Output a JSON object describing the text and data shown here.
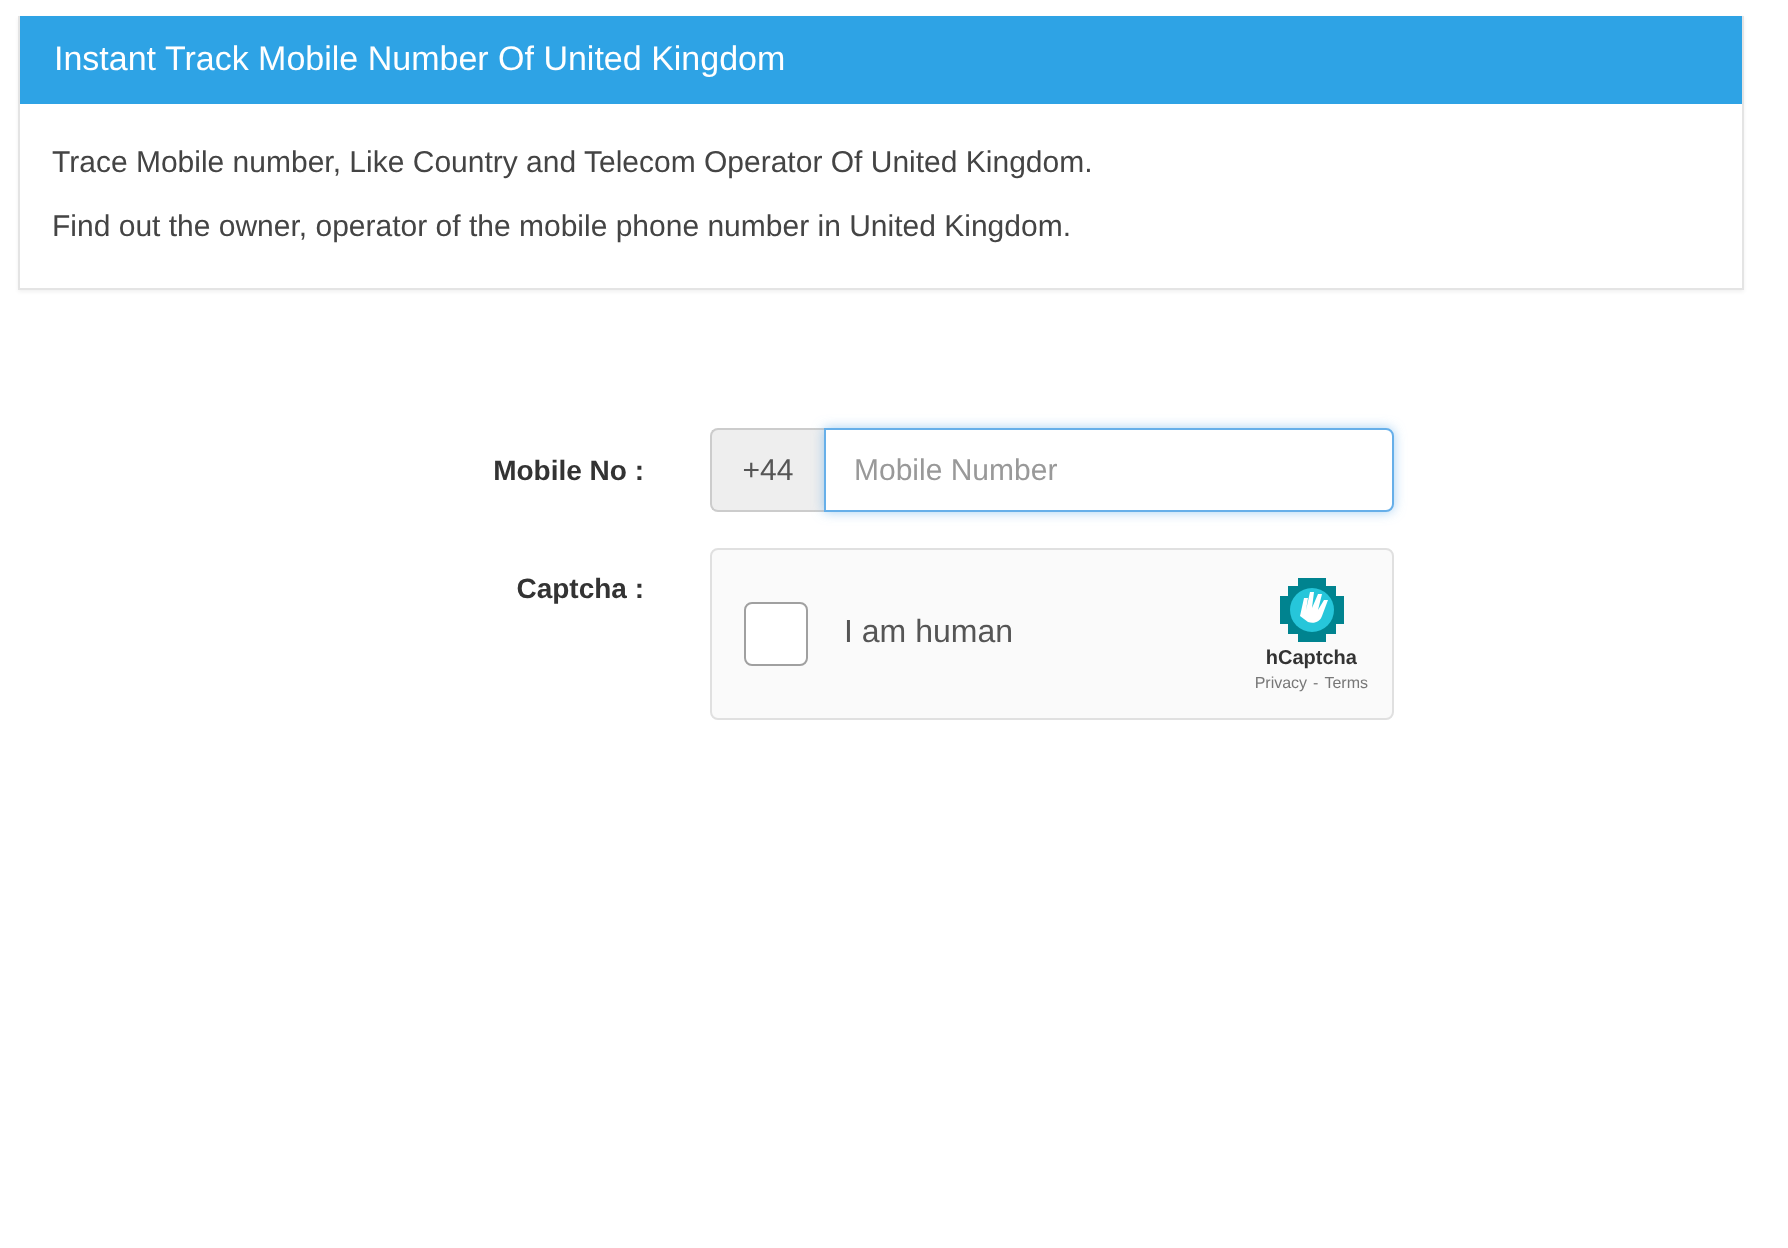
{
  "panel": {
    "title": "Instant Track Mobile Number Of United Kingdom",
    "lines": [
      "Trace Mobile number, Like Country and Telecom Operator Of United Kingdom.",
      "Find out the owner, operator of the mobile phone number in United Kingdom."
    ]
  },
  "form": {
    "mobile_label": "Mobile No :",
    "prefix": "+44",
    "mobile_placeholder": "Mobile Number",
    "captcha_label": "Captcha :"
  },
  "captcha": {
    "label": "I am human",
    "checked": false,
    "brand": "hCaptcha",
    "links": [
      "Privacy",
      "Terms"
    ],
    "separator": "-"
  }
}
